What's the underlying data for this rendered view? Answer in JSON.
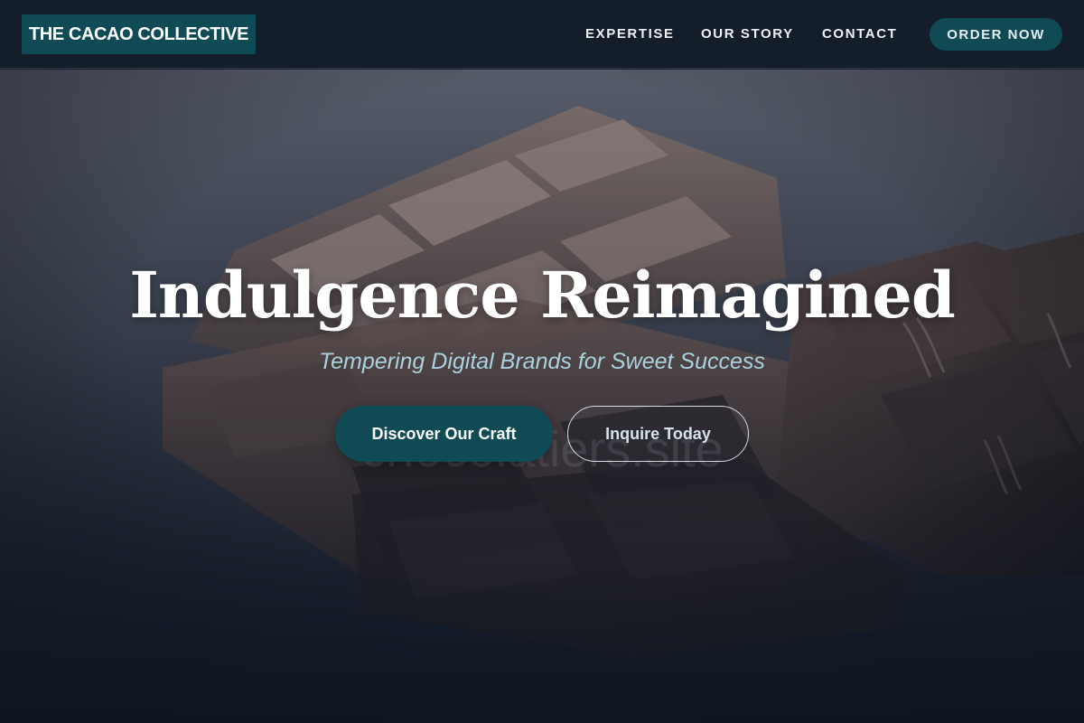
{
  "header": {
    "logo_text": "THE CACAO COLLECTIVE",
    "nav": [
      {
        "label": "EXPERTISE"
      },
      {
        "label": "OUR STORY"
      },
      {
        "label": "CONTACT"
      }
    ],
    "cta_label": "ORDER NOW"
  },
  "hero": {
    "title": "Indulgence Reimagined",
    "subtitle": "Tempering Digital Brands for Sweet Success",
    "watermark": "chocolatiers.site",
    "primary_button": "Discover Our Craft",
    "secondary_button": "Inquire Today",
    "background_image": "chocolate-bars-photo"
  },
  "colors": {
    "accent": "#0f4a55",
    "header_bg": "#141d2a",
    "subtitle": "#a9d2dc",
    "text": "#ffffff"
  }
}
